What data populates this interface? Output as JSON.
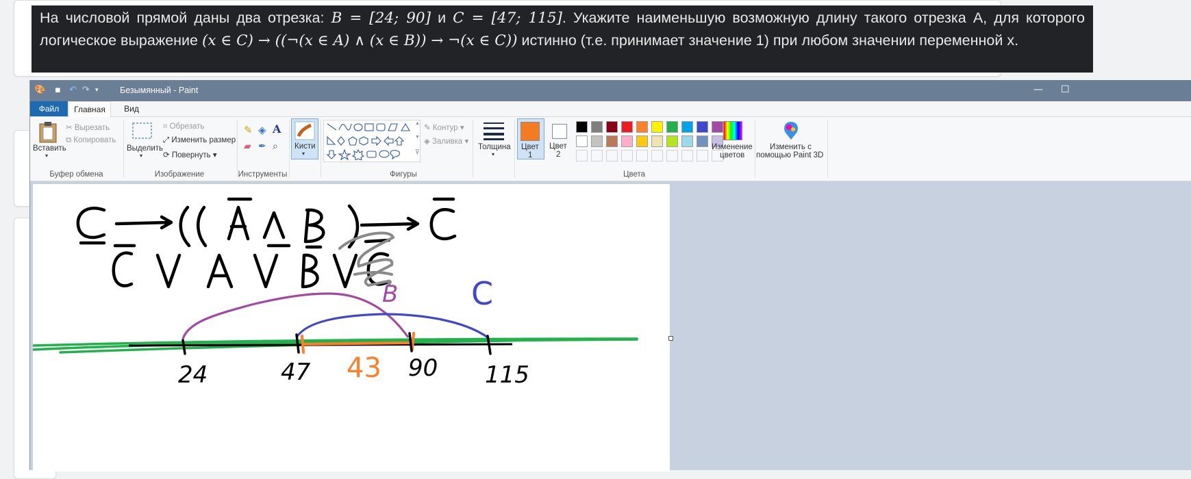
{
  "task": {
    "t1": "На числовой прямой даны два отрезка: ",
    "m1": "B = [24; 90]",
    "t2": " и ",
    "m2": "C = [47; 115]",
    "t3": ". Укажите наименьшую возможную длину такого отрезка А, для которого логическое выражение ",
    "m3": "(x ∈ C) → ((¬(x ∈ A) ∧ (x ∈ B)) → ¬(x ∈ C))",
    "t4": " истинно (т.е. принимает значение 1) при любом значении переменной х."
  },
  "window": {
    "title": "Безымянный - Paint",
    "minimize": "—",
    "maximize": "☐"
  },
  "menu": {
    "file": "Файл",
    "home": "Главная",
    "view": "Вид"
  },
  "ribbon": {
    "paste": "Вставить",
    "cut": "Вырезать",
    "copy": "Копировать",
    "clipboard_group": "Буфер обмена",
    "select": "Выделить",
    "crop": "Обрезать",
    "resize": "Изменить размер",
    "rotate": "Повернуть",
    "image_group": "Изображение",
    "tools_group": "Инструменты",
    "brushes": "Кисти",
    "shapes_group": "Фигуры",
    "outline": "Контур",
    "fill": "Заливка",
    "size": "Толщина",
    "color1": "Цвет",
    "color1_num": "1",
    "color2": "Цвет",
    "color2_num": "2",
    "edit_colors_1": "Изменение",
    "edit_colors_2": "цветов",
    "paint3d_1": "Изменить с",
    "paint3d_2": "помощью Paint 3D",
    "colors_group": "Цвета",
    "accent": "#1e6ab0",
    "color1_value": "#f47b20",
    "color2_value": "#ffffff",
    "palette_row1": [
      "#000000",
      "#7f7f7f",
      "#880015",
      "#ed1c24",
      "#ff7f27",
      "#fff200",
      "#22b14c",
      "#00a2e8",
      "#3f48cc",
      "#a349a4"
    ],
    "palette_row2": [
      "#ffffff",
      "#c3c3c3",
      "#b97a57",
      "#ffaec9",
      "#ffc90e",
      "#efe4b0",
      "#b5e61d",
      "#99d9ea",
      "#7092be",
      "#c8bfe7"
    ]
  },
  "drawing": {
    "labels": {
      "n24": "24",
      "n47": "47",
      "n90": "90",
      "n115": "115",
      "len": "43",
      "b": "B",
      "c": "C"
    },
    "colors": {
      "ink": "#000000",
      "green": "#22b14c",
      "purple": "#a349a4",
      "blue": "#3f48cc",
      "orange": "#ff7f27",
      "gray": "#7f7f7f"
    }
  }
}
